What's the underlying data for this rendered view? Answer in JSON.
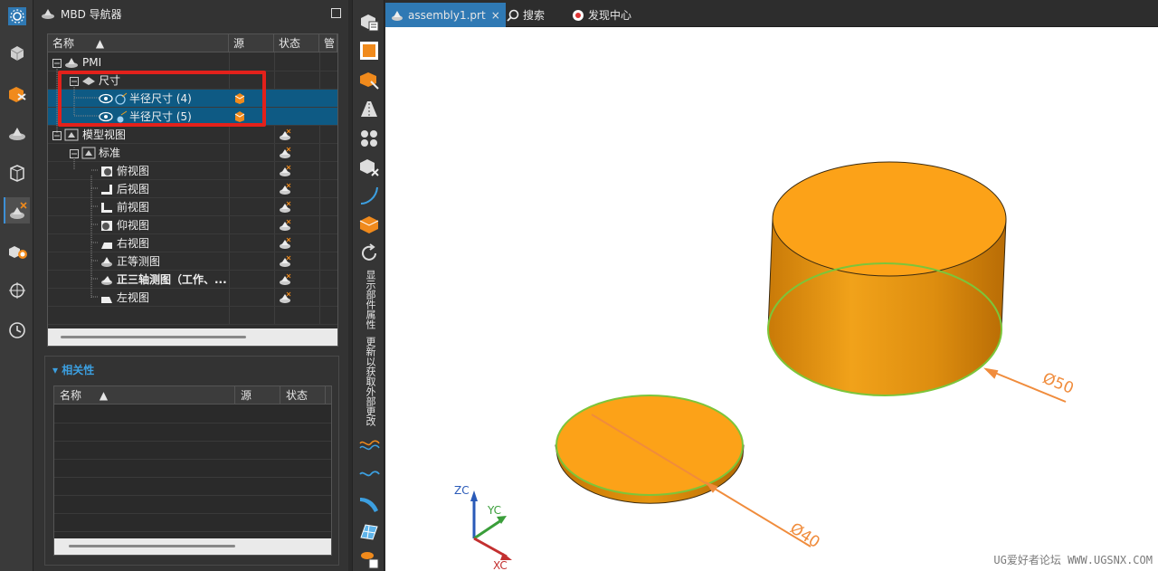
{
  "navigator": {
    "title": "MBD 导航器",
    "columns": {
      "name": "名称",
      "source": "源",
      "status": "状态",
      "manage": "管"
    },
    "rows": [
      {
        "label": "PMI",
        "bold": false,
        "selected": false
      },
      {
        "label": "尺寸",
        "bold": false,
        "selected": false
      },
      {
        "label": "半径尺寸 (4)",
        "bold": false,
        "selected": true
      },
      {
        "label": "半径尺寸 (5)",
        "bold": false,
        "selected": true
      },
      {
        "label": "模型视图",
        "bold": false,
        "selected": false
      },
      {
        "label": "标准",
        "bold": false,
        "selected": false
      },
      {
        "label": "俯视图",
        "bold": false,
        "selected": false
      },
      {
        "label": "后视图",
        "bold": false,
        "selected": false
      },
      {
        "label": "前视图",
        "bold": false,
        "selected": false
      },
      {
        "label": "仰视图",
        "bold": false,
        "selected": false
      },
      {
        "label": "右视图",
        "bold": false,
        "selected": false
      },
      {
        "label": "正等测图",
        "bold": false,
        "selected": false
      },
      {
        "label": "正三轴测图（工作、...",
        "bold": true,
        "selected": false
      },
      {
        "label": "左视图",
        "bold": false,
        "selected": false
      }
    ]
  },
  "related": {
    "title": "相关性",
    "columns": {
      "name": "名称",
      "source": "源",
      "status": "状态"
    }
  },
  "toolbar": {
    "vertical_text_1": "显示部件属性",
    "vertical_text_2": "更新以获取外部更改"
  },
  "tabs": [
    {
      "label": "assembly1.prt",
      "close": "×",
      "active": true
    },
    {
      "label": "搜索",
      "active": false
    },
    {
      "label": "发现中心",
      "active": false
    }
  ],
  "viewport": {
    "dim_large": "Ø50",
    "dim_small": "Ø40",
    "axis_x": "XC",
    "axis_y": "YC",
    "axis_z": "ZC",
    "watermark": "UG爱好者论坛 WWW.UGSNX.COM"
  },
  "colors": {
    "accent": "#2f79b4",
    "selection": "#0e5a84",
    "part": "#f5a21b",
    "highlight": "#e3211b"
  }
}
